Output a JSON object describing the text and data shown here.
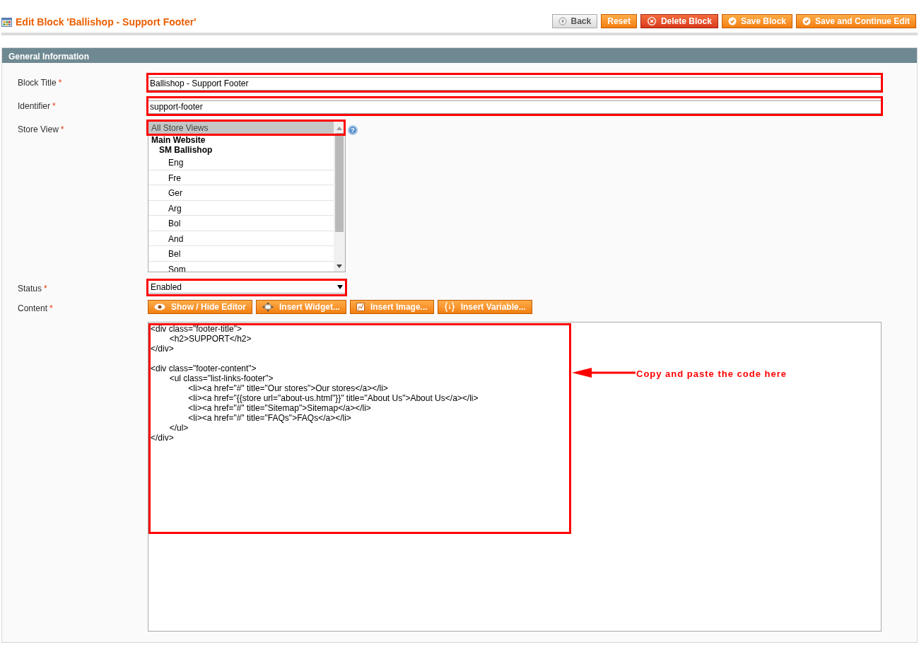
{
  "header": {
    "title": "Edit Block 'Ballishop - Support Footer'"
  },
  "actions": [
    {
      "label": "Back",
      "kind": "back"
    },
    {
      "label": "Reset",
      "kind": "plain"
    },
    {
      "label": "Delete Block",
      "kind": "delete"
    },
    {
      "label": "Save Block",
      "kind": "save"
    },
    {
      "label": "Save and Continue Edit",
      "kind": "save"
    }
  ],
  "section": {
    "title": "General Information"
  },
  "fields": {
    "block_title": {
      "label": "Block Title",
      "required_mark": "*",
      "value": "Ballishop - Support Footer",
      "highlighted": true
    },
    "identifier": {
      "label": "Identifier",
      "required_mark": "*",
      "value": "support-footer",
      "highlighted": true
    },
    "store_view": {
      "label": "Store View",
      "required_mark": "*",
      "help": "?",
      "highlighted": true,
      "options": [
        {
          "label": "All Store Views",
          "selected": true
        },
        {
          "label": "Main Website",
          "selected": false,
          "children": [
            {
              "label": "SM Ballishop",
              "selected": false,
              "children": [
                {
                  "label": "Eng",
                  "selected": false
                },
                {
                  "label": "Fre",
                  "selected": false
                },
                {
                  "label": "Ger",
                  "selected": false
                },
                {
                  "label": "Arg",
                  "selected": false
                },
                {
                  "label": "Bol",
                  "selected": false
                },
                {
                  "label": "And",
                  "selected": false
                },
                {
                  "label": "Bel",
                  "selected": false
                },
                {
                  "label": "Som",
                  "selected": false
                }
              ]
            }
          ]
        }
      ]
    },
    "status": {
      "label": "Status",
      "required_mark": "*",
      "value": "Enabled",
      "highlighted": true
    },
    "content": {
      "label": "Content",
      "required_mark": "*",
      "highlighted": true,
      "editor_buttons": [
        {
          "label": "Show / Hide Editor",
          "kind": "eye"
        },
        {
          "label": "Insert Widget...",
          "kind": "widget"
        },
        {
          "label": "Insert Image...",
          "kind": "image"
        },
        {
          "label": "Insert Variable...",
          "kind": "variable"
        }
      ],
      "value": "<div class=\"footer-title\">\n\t<h2>SUPPORT</h2>\n</div>\n\n<div class=\"footer-content\">\n\t<ul class=\"list-links-footer\">\n\t\t<li><a href=\"#\" title=\"Our stores\">Our stores</a></li>\n\t\t<li><a href=\"{{store url=\"about-us.html\"}}\" title=\"About Us\">About Us</a></li>\n\t\t<li><a href=\"#\" title=\"Sitemap\">Sitemap</a></li>\n\t\t<li><a href=\"#\" title=\"FAQs\">FAQs</a></li>\n\t</ul>\n</div>"
    }
  },
  "annotation": {
    "text": "Copy and paste the code here"
  }
}
